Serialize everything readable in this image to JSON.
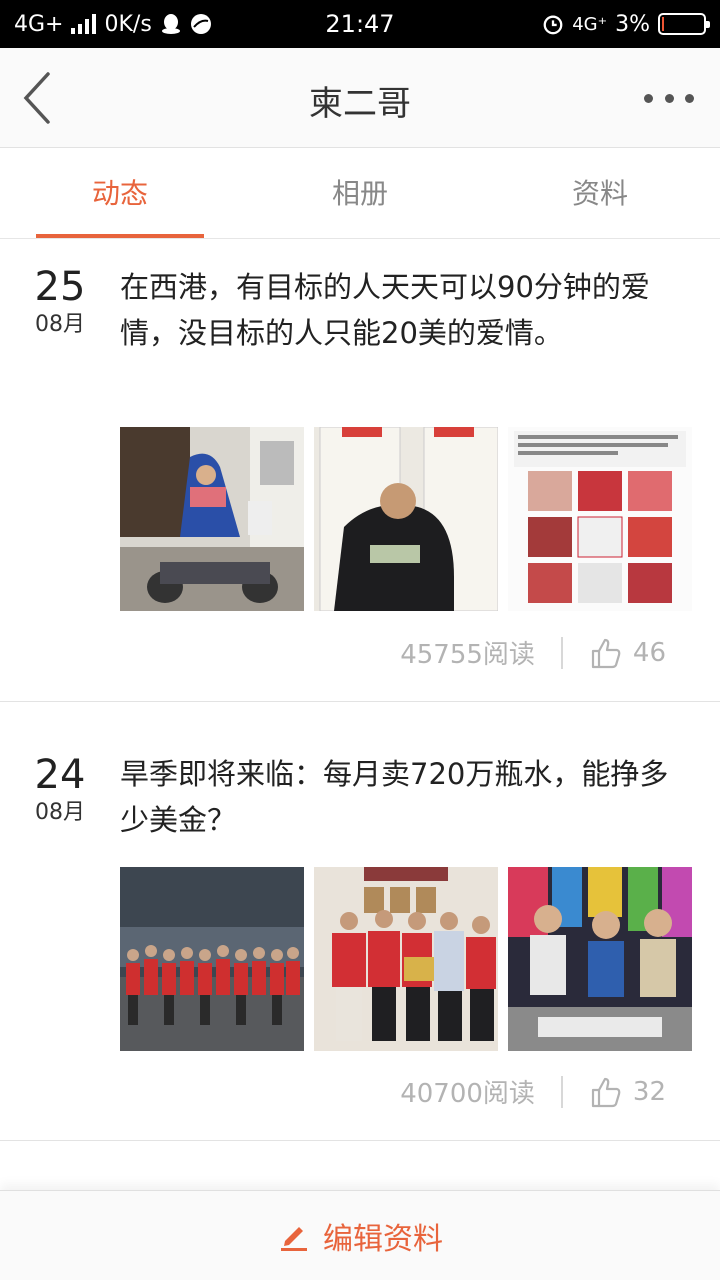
{
  "status_bar": {
    "network": "4G+",
    "speed": "0K/s",
    "time": "21:47",
    "network2": "4G⁺",
    "battery": "3%"
  },
  "nav": {
    "title": "柬二哥"
  },
  "tabs": [
    {
      "label": "动态"
    },
    {
      "label": "相册"
    },
    {
      "label": "资料"
    }
  ],
  "posts": [
    {
      "day": "25",
      "month": "08月",
      "text": "在西港，有目标的人天天可以90分钟的爱情，没目标的人只能20美的爱情。",
      "reads": "45755阅读",
      "likes": "46"
    },
    {
      "day": "24",
      "month": "08月",
      "text": "旱季即将来临：每月卖720万瓶水，能挣多少美金？",
      "reads": "40700阅读",
      "likes": "32"
    }
  ],
  "bottom": {
    "edit_label": "编辑资料"
  },
  "colors": {
    "accent": "#e8643c"
  }
}
